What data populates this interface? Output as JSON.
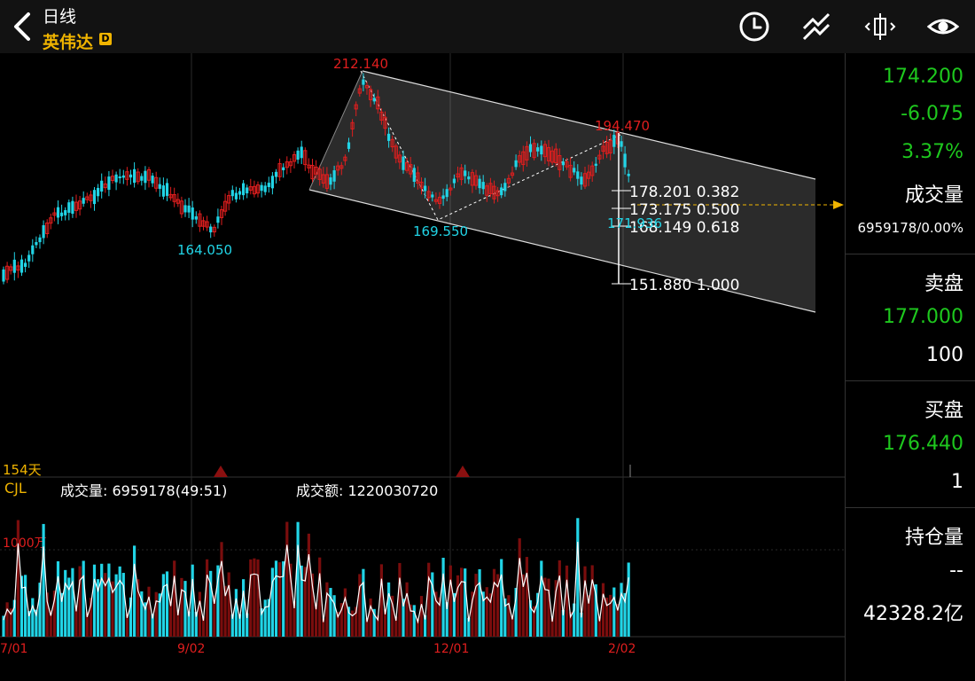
{
  "header": {
    "period": "日线",
    "stock_name": "英伟达",
    "badge": "D",
    "icons": [
      "clock-icon",
      "draw-line-icon",
      "zoom-fit-icon",
      "eye-icon"
    ]
  },
  "colors": {
    "up": "#e01e1e",
    "down": "#21d4e6",
    "accent": "#f0b400",
    "green": "#1ec81e"
  },
  "price_chart": {
    "high_label": "212.140",
    "left_low_label": "164.050",
    "mid_low_label": "169.550",
    "right_high_label": "194.470",
    "current_label": "171.936",
    "fib_levels": [
      {
        "price": "178.201",
        "ratio": "0.382"
      },
      {
        "price": "173.175",
        "ratio": "0.500"
      },
      {
        "price": "168.149",
        "ratio": "0.618"
      },
      {
        "price": "151.880",
        "ratio": "1.000"
      }
    ],
    "days_label": "154天"
  },
  "volume_panel": {
    "indicator": "CJL",
    "volume_text": "成交量: 6959178(49:51)",
    "amount_text": "成交额: 1220030720",
    "scale_label": "1000万"
  },
  "x_axis": {
    "labels": [
      "7/01",
      "9/02",
      "12/01",
      "2/02"
    ]
  },
  "side_panel": {
    "price": "174.200",
    "change": "-6.075",
    "change_pct": "3.37%",
    "volume_title": "成交量",
    "volume_value": "6959178/0.00%",
    "ask_title": "卖盘",
    "ask_price": "177.000",
    "ask_qty": "100",
    "bid_title": "买盘",
    "bid_price": "176.440",
    "bid_qty": "1",
    "oi_title": "持仓量",
    "oi_value": "--",
    "market_cap": "42328.2亿"
  },
  "chart_data": {
    "type": "candlestick",
    "fib_retracement": [
      {
        "price": 178.201,
        "ratio": 0.382
      },
      {
        "price": 173.175,
        "ratio": 0.5
      },
      {
        "price": 168.149,
        "ratio": 0.618
      },
      {
        "price": 151.88,
        "ratio": 1.0
      }
    ],
    "labeled_prices": {
      "high": 212.14,
      "left_low": 164.05,
      "mid_low": 169.55,
      "right_high": 194.47,
      "current": 171.936
    },
    "x_ticks": [
      "7/01",
      "9/02",
      "12/01",
      "2/02"
    ],
    "volume_scale_label": "1000万"
  }
}
